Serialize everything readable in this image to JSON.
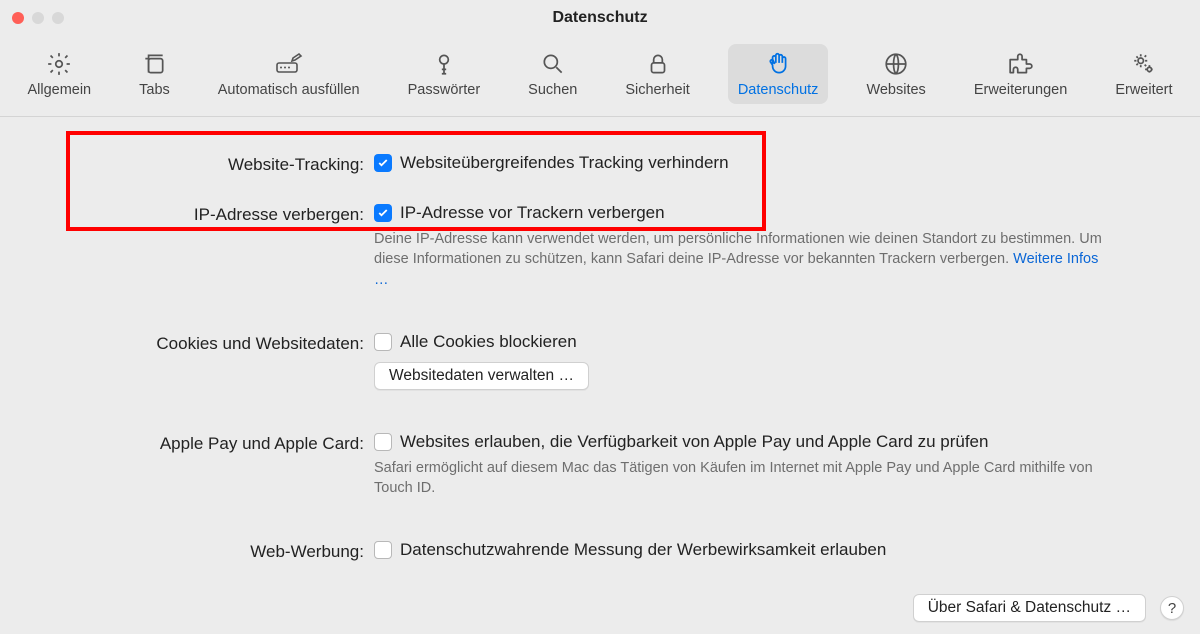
{
  "window": {
    "title": "Datenschutz"
  },
  "tabs": [
    {
      "label": "Allgemein"
    },
    {
      "label": "Tabs"
    },
    {
      "label": "Automatisch ausfüllen"
    },
    {
      "label": "Passwörter"
    },
    {
      "label": "Suchen"
    },
    {
      "label": "Sicherheit"
    },
    {
      "label": "Datenschutz"
    },
    {
      "label": "Websites"
    },
    {
      "label": "Erweiterungen"
    },
    {
      "label": "Erweitert"
    }
  ],
  "rows": {
    "tracking": {
      "label": "Website-Tracking:",
      "option": "Websiteübergreifendes Tracking verhindern"
    },
    "ip": {
      "label": "IP-Adresse verbergen:",
      "option": "IP-Adresse vor Trackern verbergen",
      "desc": "Deine IP-Adresse kann verwendet werden, um persönliche Informationen wie deinen Standort zu bestimmen. Um diese Informationen zu schützen, kann Safari deine IP-Adresse vor bekannten Trackern verbergen. ",
      "link": "Weitere Infos …"
    },
    "cookies": {
      "label": "Cookies und Websitedaten:",
      "option": "Alle Cookies blockieren",
      "button": "Websitedaten verwalten …"
    },
    "applepay": {
      "label": "Apple Pay und Apple Card:",
      "option": "Websites erlauben, die Verfügbarkeit von Apple Pay und Apple Card zu prüfen",
      "desc": "Safari ermöglicht auf diesem Mac das Tätigen von Käufen im Internet mit Apple Pay und Apple Card mithilfe von Touch ID."
    },
    "ads": {
      "label": "Web-Werbung:",
      "option": "Datenschutzwahrende Messung der Werbewirksamkeit erlauben"
    }
  },
  "footer": {
    "about": "Über Safari & Datenschutz …",
    "help": "?"
  }
}
